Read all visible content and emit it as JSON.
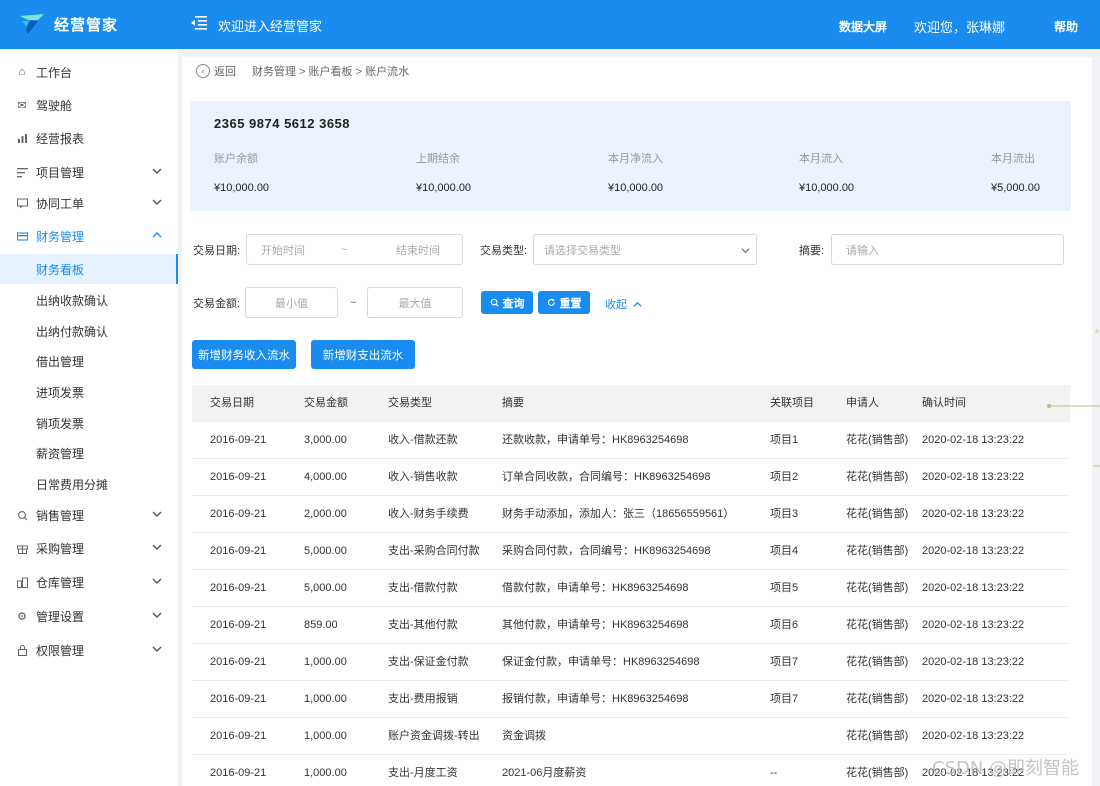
{
  "header": {
    "app_name": "经营管家",
    "welcome": "欢迎进入经营管家",
    "data_screen": "数据大屏",
    "greeting": "欢迎您，张琳娜",
    "help": "帮助",
    "brand_color": "#1a8cf0"
  },
  "sidebar": {
    "items": [
      {
        "label": "工作台",
        "icon": "home-icon"
      },
      {
        "label": "驾驶舱",
        "icon": "mail-icon"
      },
      {
        "label": "经营报表",
        "icon": "bar-chart-icon"
      },
      {
        "label": "项目管理",
        "icon": "list-icon"
      },
      {
        "label": "协同工单",
        "icon": "comment-icon"
      },
      {
        "label": "财务管理",
        "icon": "wallet-icon"
      },
      {
        "label": "销售管理",
        "icon": "search-icon"
      },
      {
        "label": "采购管理",
        "icon": "gift-icon"
      },
      {
        "label": "仓库管理",
        "icon": "warehouse-icon"
      },
      {
        "label": "管理设置",
        "icon": "gear-icon"
      },
      {
        "label": "权限管理",
        "icon": "lock-icon"
      }
    ],
    "finance_sub": [
      "财务看板",
      "出纳收款确认",
      "出纳付款确认",
      "借出管理",
      "进项发票",
      "销项发票",
      "薪资管理",
      "日常费用分摊"
    ]
  },
  "breadcrumb": {
    "back": "返回",
    "path": "财务管理 > 账户看板 > 账户流水"
  },
  "account": {
    "number": "2365 9874 5612 3658",
    "stats": [
      {
        "label": "账户余额",
        "value": "¥10,000.00"
      },
      {
        "label": "上期结余",
        "value": "¥10,000.00"
      },
      {
        "label": "本月净流入",
        "value": "¥10,000.00"
      },
      {
        "label": "本月流入",
        "value": "¥10,000.00"
      },
      {
        "label": "本月流出",
        "value": "¥5,000.00"
      }
    ]
  },
  "filters": {
    "date_label": "交易日期:",
    "start_placeholder": "开始时间",
    "tilde": "~",
    "end_placeholder": "结束时间",
    "type_label": "交易类型:",
    "type_placeholder": "请选择交易类型",
    "summary_label": "摘要:",
    "summary_placeholder": "请输入",
    "amount_label": "交易金额:",
    "min_placeholder": "最小值",
    "max_placeholder": "最大值",
    "query": "查询",
    "reset": "重置",
    "collapse": "收起"
  },
  "actions": {
    "add_income": "新增财务收入流水",
    "add_expense": "新增财支出流水"
  },
  "table": {
    "columns": [
      "交易日期",
      "交易金额",
      "交易类型",
      "摘要",
      "关联项目",
      "申请人",
      "确认时间"
    ],
    "rows": [
      [
        "2016-09-21",
        "3,000.00",
        "收入-借款还款",
        "还款收款，申请单号：HK8963254698",
        "项目1",
        "花花(销售部)",
        "2020-02-18  13:23:22"
      ],
      [
        "2016-09-21",
        "4,000.00",
        "收入-销售收款",
        "订单合同收款，合同编号：HK8963254698",
        "项目2",
        "花花(销售部)",
        "2020-02-18  13:23:22"
      ],
      [
        "2016-09-21",
        "2,000.00",
        "收入-财务手续费",
        "财务手动添加，添加人：张三（18656559561）",
        "项目3",
        "花花(销售部)",
        "2020-02-18  13:23:22"
      ],
      [
        "2016-09-21",
        "5,000.00",
        "支出-采购合同付款",
        "采购合同付款，合同编号：HK8963254698",
        "项目4",
        "花花(销售部)",
        "2020-02-18  13:23:22"
      ],
      [
        "2016-09-21",
        "5,000.00",
        "支出-借款付款",
        "借款付款，申请单号：HK8963254698",
        "项目5",
        "花花(销售部)",
        "2020-02-18  13:23:22"
      ],
      [
        "2016-09-21",
        "859.00",
        "支出-其他付款",
        "其他付款，申请单号：HK8963254698",
        "项目6",
        "花花(销售部)",
        "2020-02-18  13:23:22"
      ],
      [
        "2016-09-21",
        "1,000.00",
        "支出-保证金付款",
        "保证金付款，申请单号：HK8963254698",
        "项目7",
        "花花(销售部)",
        "2020-02-18  13:23:22"
      ],
      [
        "2016-09-21",
        "1,000.00",
        "支出-费用报销",
        "报销付款，申请单号：HK8963254698",
        "项目7",
        "花花(销售部)",
        "2020-02-18  13:23:22"
      ],
      [
        "2016-09-21",
        "1,000.00",
        "账户资金调拨-转出",
        "资金调拨",
        "",
        "花花(销售部)",
        "2020-02-18  13:23:22"
      ],
      [
        "2016-09-21",
        "1,000.00",
        "支出-月度工资",
        "2021-06月度薪资",
        "--",
        "花花(销售部)",
        "2020-02-18  13:23:22"
      ]
    ]
  },
  "watermark": "CSDN @即刻智能"
}
